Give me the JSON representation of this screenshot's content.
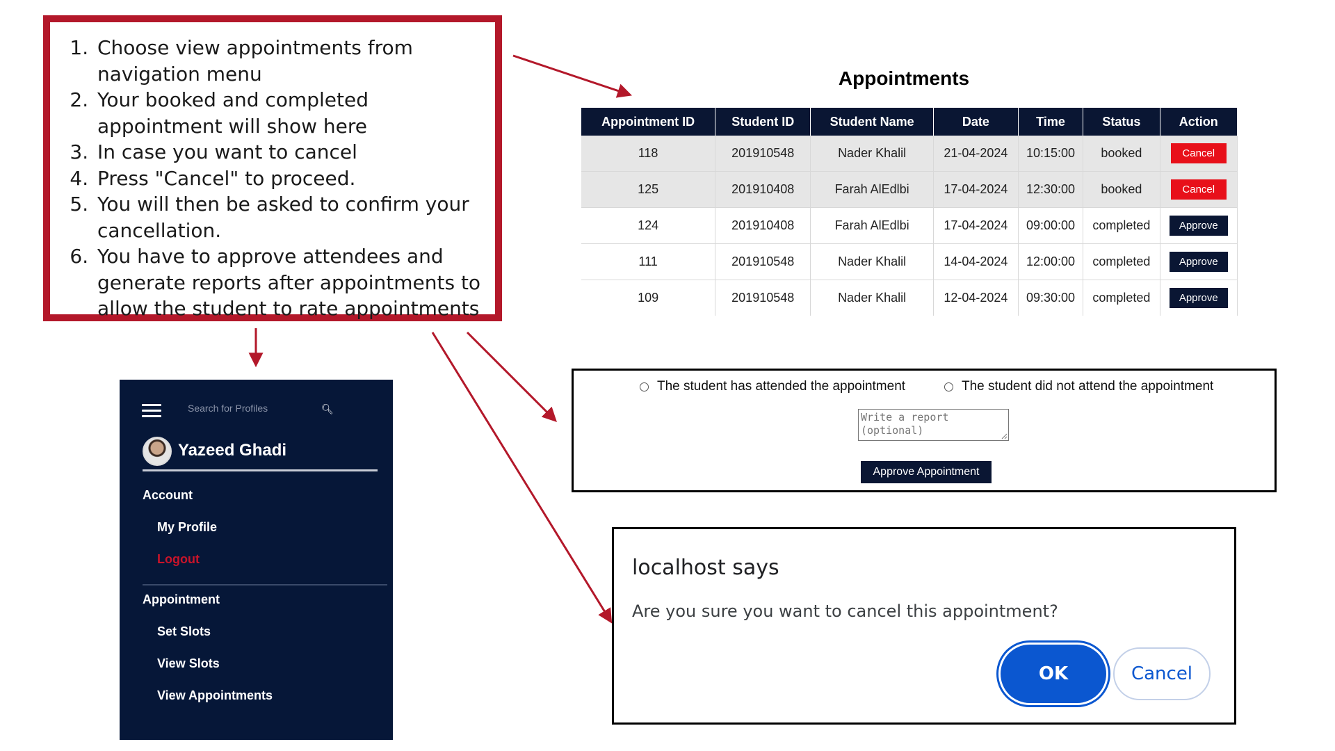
{
  "instructions": [
    "Choose view appointments from navigation menu",
    "Your booked and completed appointment will show here",
    "In case you want to cancel",
    "Press \"Cancel\" to proceed.",
    "You will then be asked to confirm your cancellation.",
    "You have to approve attendees and generate reports after appointments to allow the student to rate appointments"
  ],
  "appointments": {
    "title": "Appointments",
    "columns": [
      "Appointment ID",
      "Student ID",
      "Student Name",
      "Date",
      "Time",
      "Status",
      "Action"
    ],
    "rows": [
      {
        "id": "118",
        "student_id": "201910548",
        "name": "Nader Khalil",
        "date": "21-04-2024",
        "time": "10:15:00",
        "status": "booked",
        "action": "Cancel"
      },
      {
        "id": "125",
        "student_id": "201910408",
        "name": "Farah AlEdlbi",
        "date": "17-04-2024",
        "time": "12:30:00",
        "status": "booked",
        "action": "Cancel"
      },
      {
        "id": "124",
        "student_id": "201910408",
        "name": "Farah AlEdlbi",
        "date": "17-04-2024",
        "time": "09:00:00",
        "status": "completed",
        "action": "Approve"
      },
      {
        "id": "111",
        "student_id": "201910548",
        "name": "Nader Khalil",
        "date": "14-04-2024",
        "time": "12:00:00",
        "status": "completed",
        "action": "Approve"
      },
      {
        "id": "109",
        "student_id": "201910548",
        "name": "Nader Khalil",
        "date": "12-04-2024",
        "time": "09:30:00",
        "status": "completed",
        "action": "Approve"
      }
    ]
  },
  "sidebar": {
    "search_placeholder": "Search for Profiles",
    "user_name": "Yazeed Ghadi",
    "account_heading": "Account",
    "account_items": [
      "My Profile",
      "Logout"
    ],
    "appointment_heading": "Appointment",
    "appointment_items": [
      "Set Slots",
      "View Slots",
      "View Appointments"
    ]
  },
  "approve_panel": {
    "radio_attended": "The student has attended the appointment",
    "radio_not_attended": "The student did not attend the appointment",
    "report_placeholder": "Write a report\n(optional)",
    "approve_button": "Approve Appointment"
  },
  "dialog": {
    "title": "localhost says",
    "message": "Are you sure you want to cancel this appointment?",
    "ok_label": "OK",
    "cancel_label": "Cancel"
  },
  "colors": {
    "accent_red": "#b3182a",
    "navy": "#0a1633",
    "cancel_red": "#e8101a",
    "dialog_blue": "#0b57d0"
  }
}
